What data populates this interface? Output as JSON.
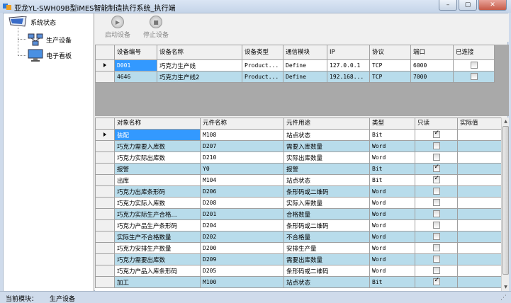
{
  "window": {
    "title": "亚龙YL-SWH09B型iMES智能制造执行系统_执行端",
    "minimize": "–",
    "maximize": "▢",
    "close": "✕"
  },
  "tree": {
    "root": "系统状态",
    "children": [
      "生产设备",
      "电子看板"
    ]
  },
  "toolbar": {
    "start": "启动设备",
    "stop": "停止设备",
    "start_icon": "▶",
    "stop_icon": "■"
  },
  "device_grid": {
    "headers": [
      "设备编号",
      "设备名称",
      "设备类型",
      "通信模块",
      "IP",
      "协议",
      "端口",
      "已连接"
    ],
    "rows": [
      {
        "code": "D001",
        "name": "巧克力生产线",
        "type": "Product...",
        "module": "Define",
        "ip": "127.0.0.1",
        "protocol": "TCP",
        "port": "6000",
        "connected": false
      },
      {
        "code": "4646",
        "name": "巧克力生产线2",
        "type": "Product...",
        "module": "Define",
        "ip": "192.168...",
        "protocol": "TCP",
        "port": "7000",
        "connected": false
      }
    ]
  },
  "element_grid": {
    "headers": [
      "对象名称",
      "元件名称",
      "元件用途",
      "类型",
      "只读",
      "实际值"
    ],
    "rows": [
      {
        "object": "装配",
        "element": "M108",
        "usage": "站点状态",
        "type": "Bit",
        "readonly": true,
        "value": ""
      },
      {
        "object": "巧克力需要入库数",
        "element": "D207",
        "usage": "需要入库数量",
        "type": "Word",
        "readonly": false,
        "value": ""
      },
      {
        "object": "巧克力实际出库数",
        "element": "D210",
        "usage": "实际出库数量",
        "type": "Word",
        "readonly": false,
        "value": ""
      },
      {
        "object": "报警",
        "element": "Y0",
        "usage": "报警",
        "type": "Bit",
        "readonly": true,
        "value": ""
      },
      {
        "object": "出库",
        "element": "M104",
        "usage": "站点状态",
        "type": "Bit",
        "readonly": true,
        "value": ""
      },
      {
        "object": "巧克力出库条形码",
        "element": "D206",
        "usage": "条形码或二维码",
        "type": "Word",
        "readonly": false,
        "value": ""
      },
      {
        "object": "巧克力实际入库数",
        "element": "D208",
        "usage": "实际入库数量",
        "type": "Word",
        "readonly": false,
        "value": ""
      },
      {
        "object": "巧克力实际生产合格...",
        "element": "D201",
        "usage": "合格数量",
        "type": "Word",
        "readonly": false,
        "value": ""
      },
      {
        "object": "巧克力产品生产条形码",
        "element": "D204",
        "usage": "条形码或二维码",
        "type": "Word",
        "readonly": false,
        "value": ""
      },
      {
        "object": "实际生产不合格数量",
        "element": "D202",
        "usage": "不合格量",
        "type": "Word",
        "readonly": false,
        "value": ""
      },
      {
        "object": "巧克力安排生产数量",
        "element": "D200",
        "usage": "安排生产量",
        "type": "Word",
        "readonly": false,
        "value": ""
      },
      {
        "object": "巧克力需要出库数",
        "element": "D209",
        "usage": "需要出库数量",
        "type": "Word",
        "readonly": false,
        "value": ""
      },
      {
        "object": "巧克力产品入库条形码",
        "element": "D205",
        "usage": "条形码或二维码",
        "type": "Word",
        "readonly": false,
        "value": ""
      },
      {
        "object": "加工",
        "element": "M100",
        "usage": "站点状态",
        "type": "Bit",
        "readonly": true,
        "value": ""
      }
    ]
  },
  "statusbar": {
    "label": "当前模块：",
    "value": "生产设备"
  },
  "colors": {
    "selection": "#3399ff",
    "alt_row": "#b8dceb"
  }
}
